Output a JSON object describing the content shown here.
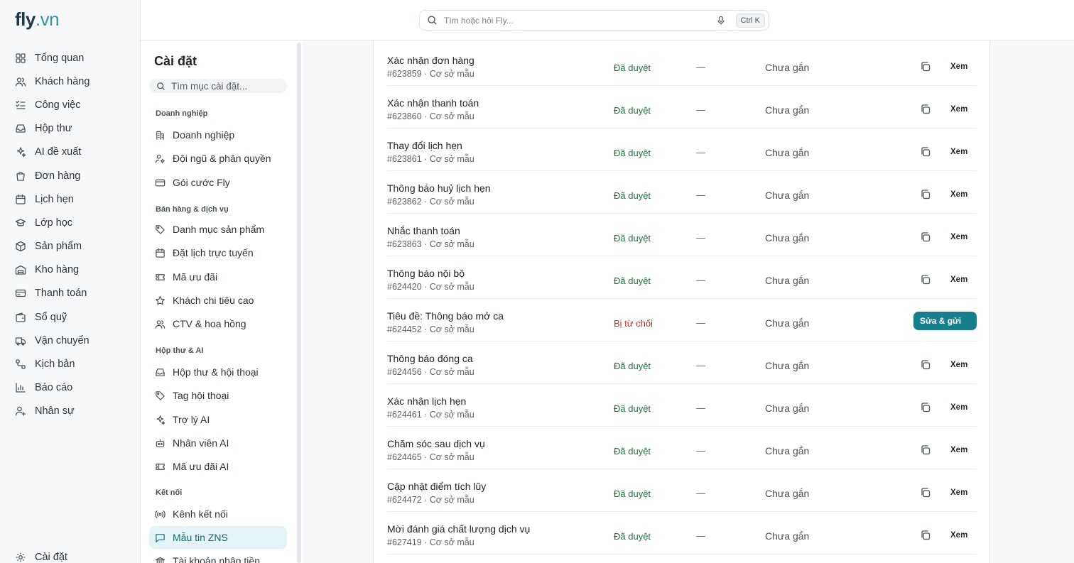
{
  "app": {
    "logo_main": "fly",
    "logo_domain": ".vn"
  },
  "search": {
    "placeholder": "Tìm hoặc hỏi Fly...",
    "shortcut": "Ctrl K"
  },
  "nav": {
    "items": [
      {
        "label": "Tổng quan",
        "icon": "grid-icon"
      },
      {
        "label": "Khách hàng",
        "icon": "users-icon"
      },
      {
        "label": "Công việc",
        "icon": "checklist-icon"
      },
      {
        "label": "Hộp thư",
        "icon": "inbox-icon"
      },
      {
        "label": "AI đề xuất",
        "icon": "sparkles-icon"
      },
      {
        "label": "Đơn hàng",
        "icon": "shopping-bag-icon"
      },
      {
        "label": "Lịch hẹn",
        "icon": "calendar-icon"
      },
      {
        "label": "Lớp học",
        "icon": "graduation-cap-icon"
      },
      {
        "label": "Sản phẩm",
        "icon": "box-icon"
      },
      {
        "label": "Kho hàng",
        "icon": "warehouse-icon"
      },
      {
        "label": "Thanh toán",
        "icon": "credit-card-icon"
      },
      {
        "label": "Sổ quỹ",
        "icon": "wallet-icon"
      },
      {
        "label": "Vận chuyển",
        "icon": "truck-icon"
      },
      {
        "label": "Kịch bản",
        "icon": "workflow-icon"
      },
      {
        "label": "Báo cáo",
        "icon": "bar-chart-icon"
      },
      {
        "label": "Nhân sự",
        "icon": "user-icon"
      }
    ],
    "settings_label": "Cài đặt"
  },
  "settings_panel": {
    "title": "Cài đặt",
    "search_placeholder": "Tìm mục cài đặt...",
    "groups": [
      {
        "label": "Doanh nghiệp"
      },
      {
        "label": "Bán hàng & dịch vụ"
      },
      {
        "label": "Hộp thư & AI"
      },
      {
        "label": "Kết nối"
      }
    ],
    "items": [
      {
        "label": "Doanh nghiệp"
      },
      {
        "label": "Đội ngũ & phân quyền"
      },
      {
        "label": "Gói cước Fly"
      },
      {
        "label": "Danh mục sản phẩm"
      },
      {
        "label": "Đặt lịch trực tuyến"
      },
      {
        "label": "Mã ưu đãi"
      },
      {
        "label": "Khách chi tiêu cao"
      },
      {
        "label": "CTV & hoa hồng"
      },
      {
        "label": "Hộp thư & hội thoại"
      },
      {
        "label": "Tag hội thoại"
      },
      {
        "label": "Trợ lý AI"
      },
      {
        "label": "Nhân viên AI"
      },
      {
        "label": "Mã ưu đãi AI"
      },
      {
        "label": "Kênh kết nối"
      },
      {
        "label": "Mẫu tin ZNS"
      },
      {
        "label": "Tài khoản nhận tiền"
      }
    ]
  },
  "templates": {
    "sep": " · ",
    "source": "Cơ sở mẫu",
    "dash": "—",
    "attach": "Chưa gắn",
    "view_label": "Xem",
    "resend_label": "Sửa & gửi lại",
    "rows": [
      {
        "name": "Xác nhận đơn hàng",
        "id": "#623859",
        "status": "Đã duyệt"
      },
      {
        "name": "Xác nhận thanh toán",
        "id": "#623860",
        "status": "Đã duyệt"
      },
      {
        "name": "Thay đổi lịch hẹn",
        "id": "#623861",
        "status": "Đã duyệt"
      },
      {
        "name": "Thông báo huỷ lịch hẹn",
        "id": "#623862",
        "status": "Đã duyệt"
      },
      {
        "name": "Nhắc thanh toán",
        "id": "#623863",
        "status": "Đã duyệt"
      },
      {
        "name": "Thông báo nội bộ",
        "id": "#624420",
        "status": "Đã duyệt"
      },
      {
        "name": "Tiêu đề: Thông báo mở ca",
        "id": "#624452",
        "status": "Bị từ chối"
      },
      {
        "name": "Thông báo đóng ca",
        "id": "#624456",
        "status": "Đã duyệt"
      },
      {
        "name": "Xác nhận lịch hẹn",
        "id": "#624461",
        "status": "Đã duyệt"
      },
      {
        "name": "Chăm sóc sau dịch vụ",
        "id": "#624465",
        "status": "Đã duyệt"
      },
      {
        "name": "Cập nhật điểm tích lũy",
        "id": "#624472",
        "status": "Đã duyệt"
      },
      {
        "name": "Mời đánh giá chất lượng dịch vụ",
        "id": "#627419",
        "status": "Đã duyệt"
      }
    ]
  },
  "colors": {
    "accent": "#177e8e",
    "approved": "#1e7a3c",
    "rejected": "#c23030"
  }
}
